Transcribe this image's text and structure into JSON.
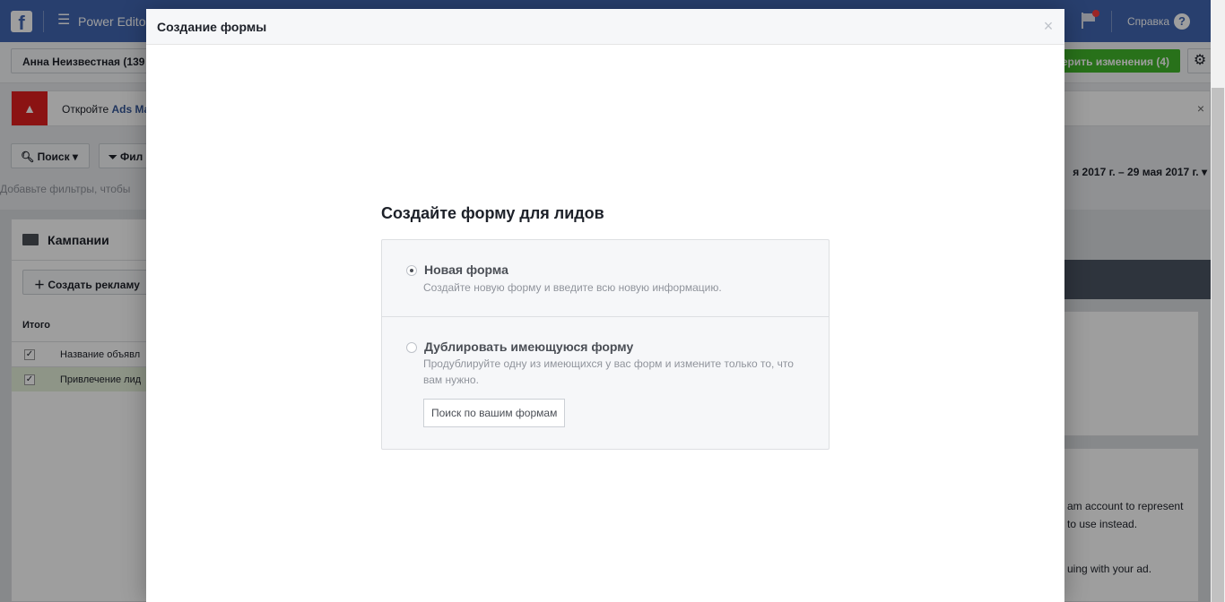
{
  "topbar": {
    "app_name": "Power Editor",
    "help_label": "Справка"
  },
  "subbar": {
    "account_name": "Анна Неизвестная (139",
    "review_button": "ерить изменения (4)"
  },
  "alert": {
    "text_prefix": "Откройте ",
    "link": "Ads Ma"
  },
  "toolbar": {
    "search_label": "Поиск",
    "filter_label": "Фил",
    "filter_hint": "Добавьте фильтры, чтобы",
    "date_range": "я 2017 г. – 29 мая 2017 г."
  },
  "campaigns": {
    "title": "Кампании",
    "create_button": "Создать рекламу",
    "total_label": "Итого",
    "rows": [
      "Название объявл",
      "Привлечение лид"
    ]
  },
  "right_panel": {
    "text_lines": [
      "am account to represent",
      "to use instead.",
      "uing with your ad."
    ]
  },
  "modal": {
    "title": "Создание формы",
    "close_glyph": "×",
    "section_title": "Создайте форму для лидов",
    "options": [
      {
        "label": "Новая форма",
        "description": "Создайте новую форму и введите всю новую информацию.",
        "selected": true
      },
      {
        "label": "Дублировать имеющуюся форму",
        "description": "Продублируйте одну из имеющихся у вас форм и измените только то, что вам нужно.",
        "selected": false
      }
    ],
    "search_placeholder": "Поиск по вашим формам"
  }
}
